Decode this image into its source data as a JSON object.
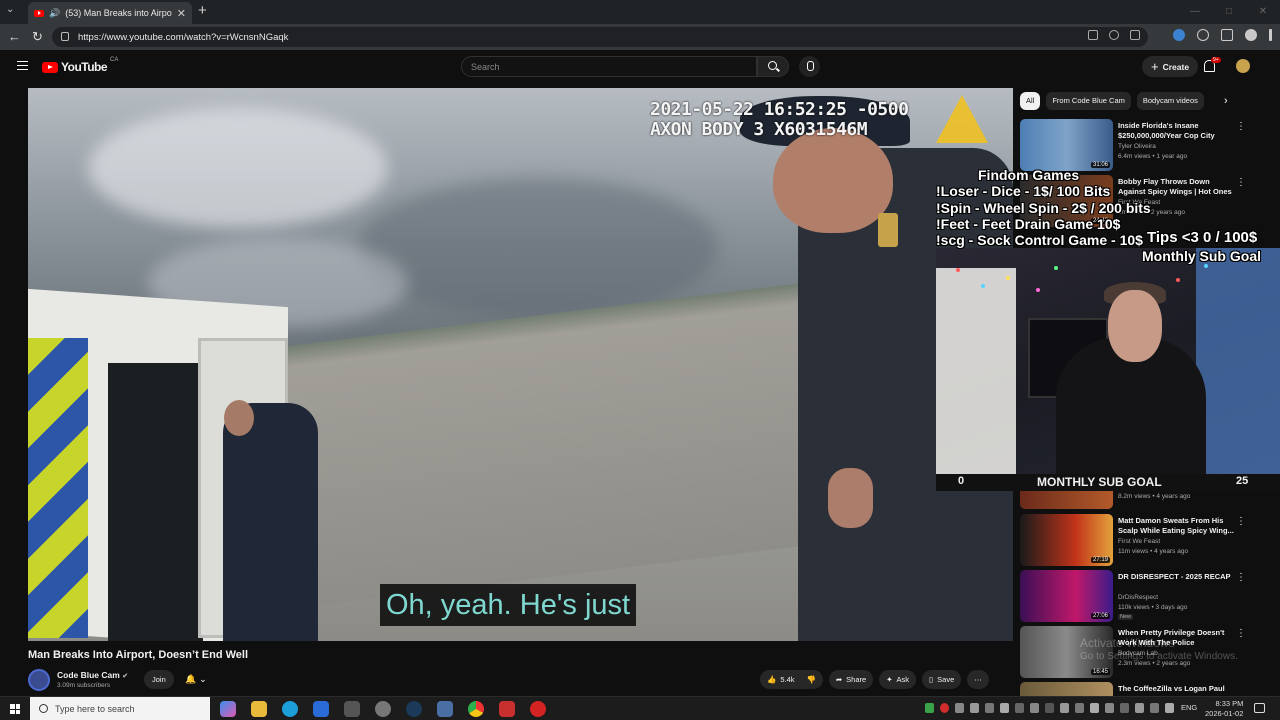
{
  "browser": {
    "tab_title": "(53) Man Breaks into Airport",
    "url": "https://www.youtube.com/watch?v=rWcnsnNGaqk"
  },
  "header": {
    "logo_text": "YouTube",
    "logo_region": "CA",
    "search_placeholder": "Search",
    "create_label": "Create",
    "notif_badge": "9+"
  },
  "video": {
    "timestamp_line1": "2021-05-22 16:52:25 -0500",
    "timestamp_line2": "AXON BODY 3 X6031546M",
    "caption": "Oh, yeah. He's just",
    "title": "Man Breaks Into Airport, Doesn’t End Well",
    "channel": "Code Blue Cam",
    "subscribers": "3.09m subscribers",
    "join_label": "Join",
    "like_count": "5.4k",
    "share_label": "Share",
    "ask_label": "Ask",
    "save_label": "Save"
  },
  "overlay": {
    "title": "Findom Games",
    "lines": [
      "!Loser - Dice - 1$/ 100 Bits",
      "!Spin - Wheel Spin - 2$ / 200 bits",
      "!Feet - Feet Drain Game  10$",
      "!scg - Sock Control Game - 10$"
    ],
    "tips": "Tips <3 0 / 100$",
    "monthly_sub_goal_top": "Monthly Sub Goal",
    "goal_start": "0",
    "goal_label": "MONTHLY SUB GOAL",
    "goal_end": "25"
  },
  "sidebar": {
    "chips": [
      "All",
      "From Code Blue Cam",
      "Bodycam videos"
    ],
    "recs": [
      {
        "title": "Inside Florida's Insane $250,000,000/Year Cop City",
        "channel": "Tyler Oliveira",
        "meta": "6.4m views • 1 year ago",
        "duration": "31:06"
      },
      {
        "title": "Bobby Flay Throws Down Against Spicy Wings | Hot Ones",
        "channel": "First We Feast",
        "meta": "6m views • 2 years ago",
        "duration": "24:43"
      },
      {
        "title": "Matt Damon Sweats From His Scalp While Eating Spicy Wing...",
        "channel": "First We Feast",
        "meta": "11m views • 4 years ago",
        "duration": "27:19"
      },
      {
        "title": "DR DISRESPECT - 2025 RECAP",
        "channel": "DrDisRespect",
        "meta": "110k views • 3 days ago",
        "duration": "27:06",
        "badge": "New"
      },
      {
        "title": "When Pretty Privilege Doesn't Work With The Police",
        "channel": "Bodycam Lab",
        "meta": "2.3m views • 2 years ago",
        "duration": "16:45"
      },
      {
        "title": "The CoffeeZilla vs Logan Paul",
        "channel": "",
        "meta": "",
        "duration": ""
      }
    ],
    "partial_meta": "8.2m views • 4 years ago"
  },
  "watermark": {
    "line1": "Activate Windows",
    "line2": "Go to Settings to activate Windows."
  },
  "taskbar": {
    "search_placeholder": "Type here to search",
    "lang": "ENG",
    "time": "8:33 PM",
    "date": "2026-01-02"
  }
}
